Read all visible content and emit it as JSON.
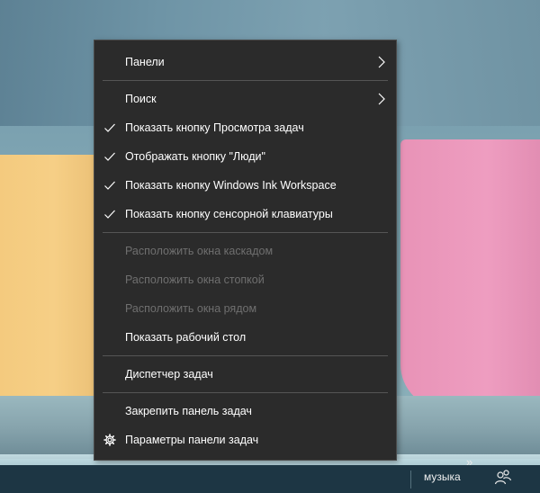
{
  "menu": {
    "items": [
      {
        "label": "Панели",
        "has_submenu": true
      },
      {
        "label": "Поиск",
        "has_submenu": true
      },
      {
        "label": "Показать кнопку Просмотра задач",
        "checked": true
      },
      {
        "label": "Отображать кнопку \"Люди\"",
        "checked": true
      },
      {
        "label": "Показать кнопку Windows Ink Workspace",
        "checked": true
      },
      {
        "label": "Показать кнопку сенсорной клавиатуры",
        "checked": true
      },
      {
        "label": "Расположить окна каскадом",
        "disabled": true
      },
      {
        "label": "Расположить окна стопкой",
        "disabled": true
      },
      {
        "label": "Расположить окна рядом",
        "disabled": true
      },
      {
        "label": "Показать рабочий стол"
      },
      {
        "label": "Диспетчер задач"
      },
      {
        "label": "Закрепить панель задач"
      },
      {
        "label": "Параметры панели задач",
        "icon": "gear-icon"
      }
    ]
  },
  "taskbar": {
    "label": "музыка",
    "chevron": "»",
    "people_icon": "people-icon"
  },
  "colors": {
    "menu_bg": "#2b2b2b",
    "menu_text": "#ffffff",
    "menu_disabled": "#6f6f6f",
    "separator": "#555555",
    "taskbar_bg": "#1d3644"
  }
}
